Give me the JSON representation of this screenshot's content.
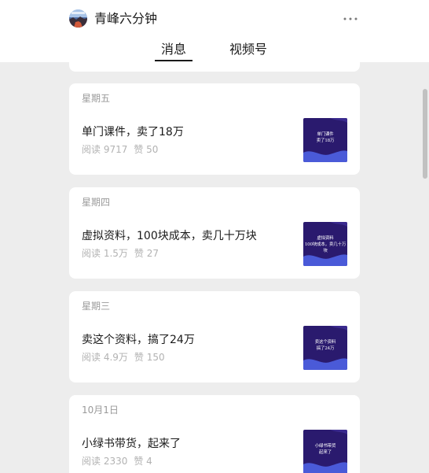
{
  "header": {
    "account_name": "青峰六分钟",
    "avatar_icon": "account-avatar",
    "more_icon": "more-horizontal-icon",
    "tabs": [
      {
        "label": "消息",
        "active": true
      },
      {
        "label": "视频号",
        "active": false
      }
    ]
  },
  "articles": [
    {
      "date": "星期五",
      "title": "单门课件，卖了18万",
      "reads": "阅读 9717",
      "likes": "赞 50",
      "thumb_text": "单门课件\n卖了18万"
    },
    {
      "date": "星期四",
      "title": "虚拟资料，100块成本，卖几十万块",
      "reads": "阅读 1.5万",
      "likes": "赞 27",
      "thumb_text": "虚拟资料\n100块成本，卖几十万块"
    },
    {
      "date": "星期三",
      "title": "卖这个资料，搞了24万",
      "reads": "阅读 4.9万",
      "likes": "赞 150",
      "thumb_text": "卖这个资料\n搞了24万"
    },
    {
      "date": "10月1日",
      "title": "小绿书带货，起来了",
      "reads": "阅读 2330",
      "likes": "赞 4",
      "thumb_text": "小绿书带货\n起来了"
    }
  ],
  "colors": {
    "page_background": "#ededed",
    "card_background": "#ffffff",
    "thumb_background": "#2a1a6e",
    "thumb_wave": "#4a5ad8",
    "muted_text": "#9a9a9a"
  }
}
